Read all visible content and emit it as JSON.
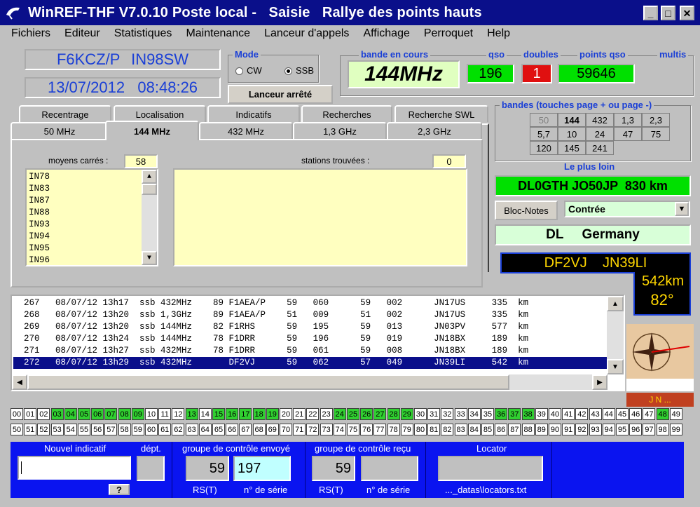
{
  "title": "WinREF-THF V7.0.10 Poste local -   Saisie   Rallye des points hauts",
  "window_buttons": {
    "minimize": "_",
    "maximize": "□",
    "close": "✕"
  },
  "menu": [
    "Fichiers",
    "Editeur",
    "Statistiques",
    "Maintenance",
    "Lanceur d'appels",
    "Affichage",
    "Perroquet",
    "Help"
  ],
  "station": {
    "callsign": "F6KCZ/P  IN98SW",
    "datetime": "13/07/2012   08:48:26"
  },
  "mode": {
    "label": "Mode",
    "options": [
      "CW",
      "SSB"
    ],
    "selected": "SSB"
  },
  "launcher_button": "Lanceur arrêté",
  "stats": {
    "band_label": "bande en cours",
    "band": "144MHz",
    "qso_label": "qso",
    "qso": "196",
    "doubles_label": "doubles",
    "doubles": "1",
    "points_label": "points qso",
    "points": "59646",
    "multis_label": "multis"
  },
  "bands": {
    "label": "bandes (touches page + ou page -)",
    "cells": [
      "50",
      "144",
      "432",
      "1,3",
      "2,3",
      "5,7",
      "10",
      "24",
      "47",
      "75",
      "120",
      "145",
      "241"
    ],
    "active": "144"
  },
  "farthest": {
    "label": "Le plus loin",
    "value": "DL0GTH JO50JP  830 km"
  },
  "bloc_notes": "Bloc-Notes",
  "contree": {
    "label": "Contrée",
    "arrow": "▼"
  },
  "country": "DL     Germany",
  "target": {
    "call": "DF2VJ    JN39LI",
    "distance": "542km",
    "azimuth": "82°"
  },
  "tabs_top": [
    "Recentrage",
    "Localisation",
    "Indicatifs",
    "Recherches",
    "Recherche SWL"
  ],
  "tabs_bottom": [
    "50 MHz",
    "144 MHz",
    "432 MHz",
    "1,3 GHz",
    "2,3 GHz"
  ],
  "moyens_carres": {
    "label": "moyens carrés :",
    "count": "58",
    "items": [
      "IN78",
      "IN83",
      "IN87",
      "IN88",
      "IN93",
      "IN94",
      "IN95",
      "IN96"
    ]
  },
  "stations_trouvees": {
    "label": "stations trouvées :",
    "count": "0"
  },
  "log": [
    "  267   08/07/12 13h17  ssb 432MHz    89 F1AEA/P    59   060      59   002      JN17US     335  km",
    "  268   08/07/12 13h20  ssb 1,3GHz    89 F1AEA/P    51   009      51   002      JN17US     335  km",
    "  269   08/07/12 13h20  ssb 144MHz    82 F1RHS      59   195      59   013      JN03PV     577  km",
    "  270   08/07/12 13h24  ssb 144MHz    78 F1DRR      59   196      59   019      JN18BX     189  km",
    "  271   08/07/12 13h27  ssb 432MHz    78 F1DRR      59   061      59   008      JN18BX     189  km",
    "  272   08/07/12 13h29  ssb 432MHz       DF2VJ      59   062      57   049      JN39LI     542  km"
  ],
  "locator_hint": "J N ...",
  "numbers_row1": [
    "00",
    "01",
    "02",
    "03",
    "04",
    "05",
    "06",
    "07",
    "08",
    "09",
    "10",
    "11",
    "12",
    "13",
    "14",
    "15",
    "16",
    "17",
    "18",
    "19",
    "20",
    "21",
    "22",
    "23",
    "24",
    "25",
    "26",
    "27",
    "28",
    "29",
    "30",
    "31",
    "32",
    "33",
    "34",
    "35",
    "36",
    "37",
    "38",
    "39",
    "40",
    "41",
    "42",
    "43",
    "44",
    "45",
    "46",
    "47",
    "48",
    "49"
  ],
  "numbers_row2": [
    "50",
    "51",
    "52",
    "53",
    "54",
    "55",
    "56",
    "57",
    "58",
    "59",
    "60",
    "61",
    "62",
    "63",
    "64",
    "65",
    "66",
    "67",
    "68",
    "69",
    "70",
    "71",
    "72",
    "73",
    "74",
    "75",
    "76",
    "77",
    "78",
    "79",
    "80",
    "81",
    "82",
    "83",
    "84",
    "85",
    "86",
    "87",
    "88",
    "89",
    "90",
    "91",
    "92",
    "93",
    "94",
    "95",
    "96",
    "97",
    "98",
    "99"
  ],
  "green_numbers": [
    "03",
    "04",
    "05",
    "06",
    "07",
    "08",
    "09",
    "13",
    "15",
    "16",
    "17",
    "18",
    "19",
    "24",
    "25",
    "26",
    "27",
    "28",
    "29",
    "36",
    "37",
    "38",
    "48"
  ],
  "entry": {
    "new_call_label": "Nouvel indicatif",
    "dept_label": "dépt.",
    "help_button": "?",
    "sent_label": "groupe de contrôle envoyé",
    "sent_rst": "59",
    "sent_serial": "197",
    "recv_label": "groupe de contrôle reçu",
    "recv_rst": "59",
    "rst_label": "RS(T)",
    "serial_label": "n° de série",
    "locator_label": "Locator",
    "locator_file": "..._datas\\locators.txt"
  }
}
